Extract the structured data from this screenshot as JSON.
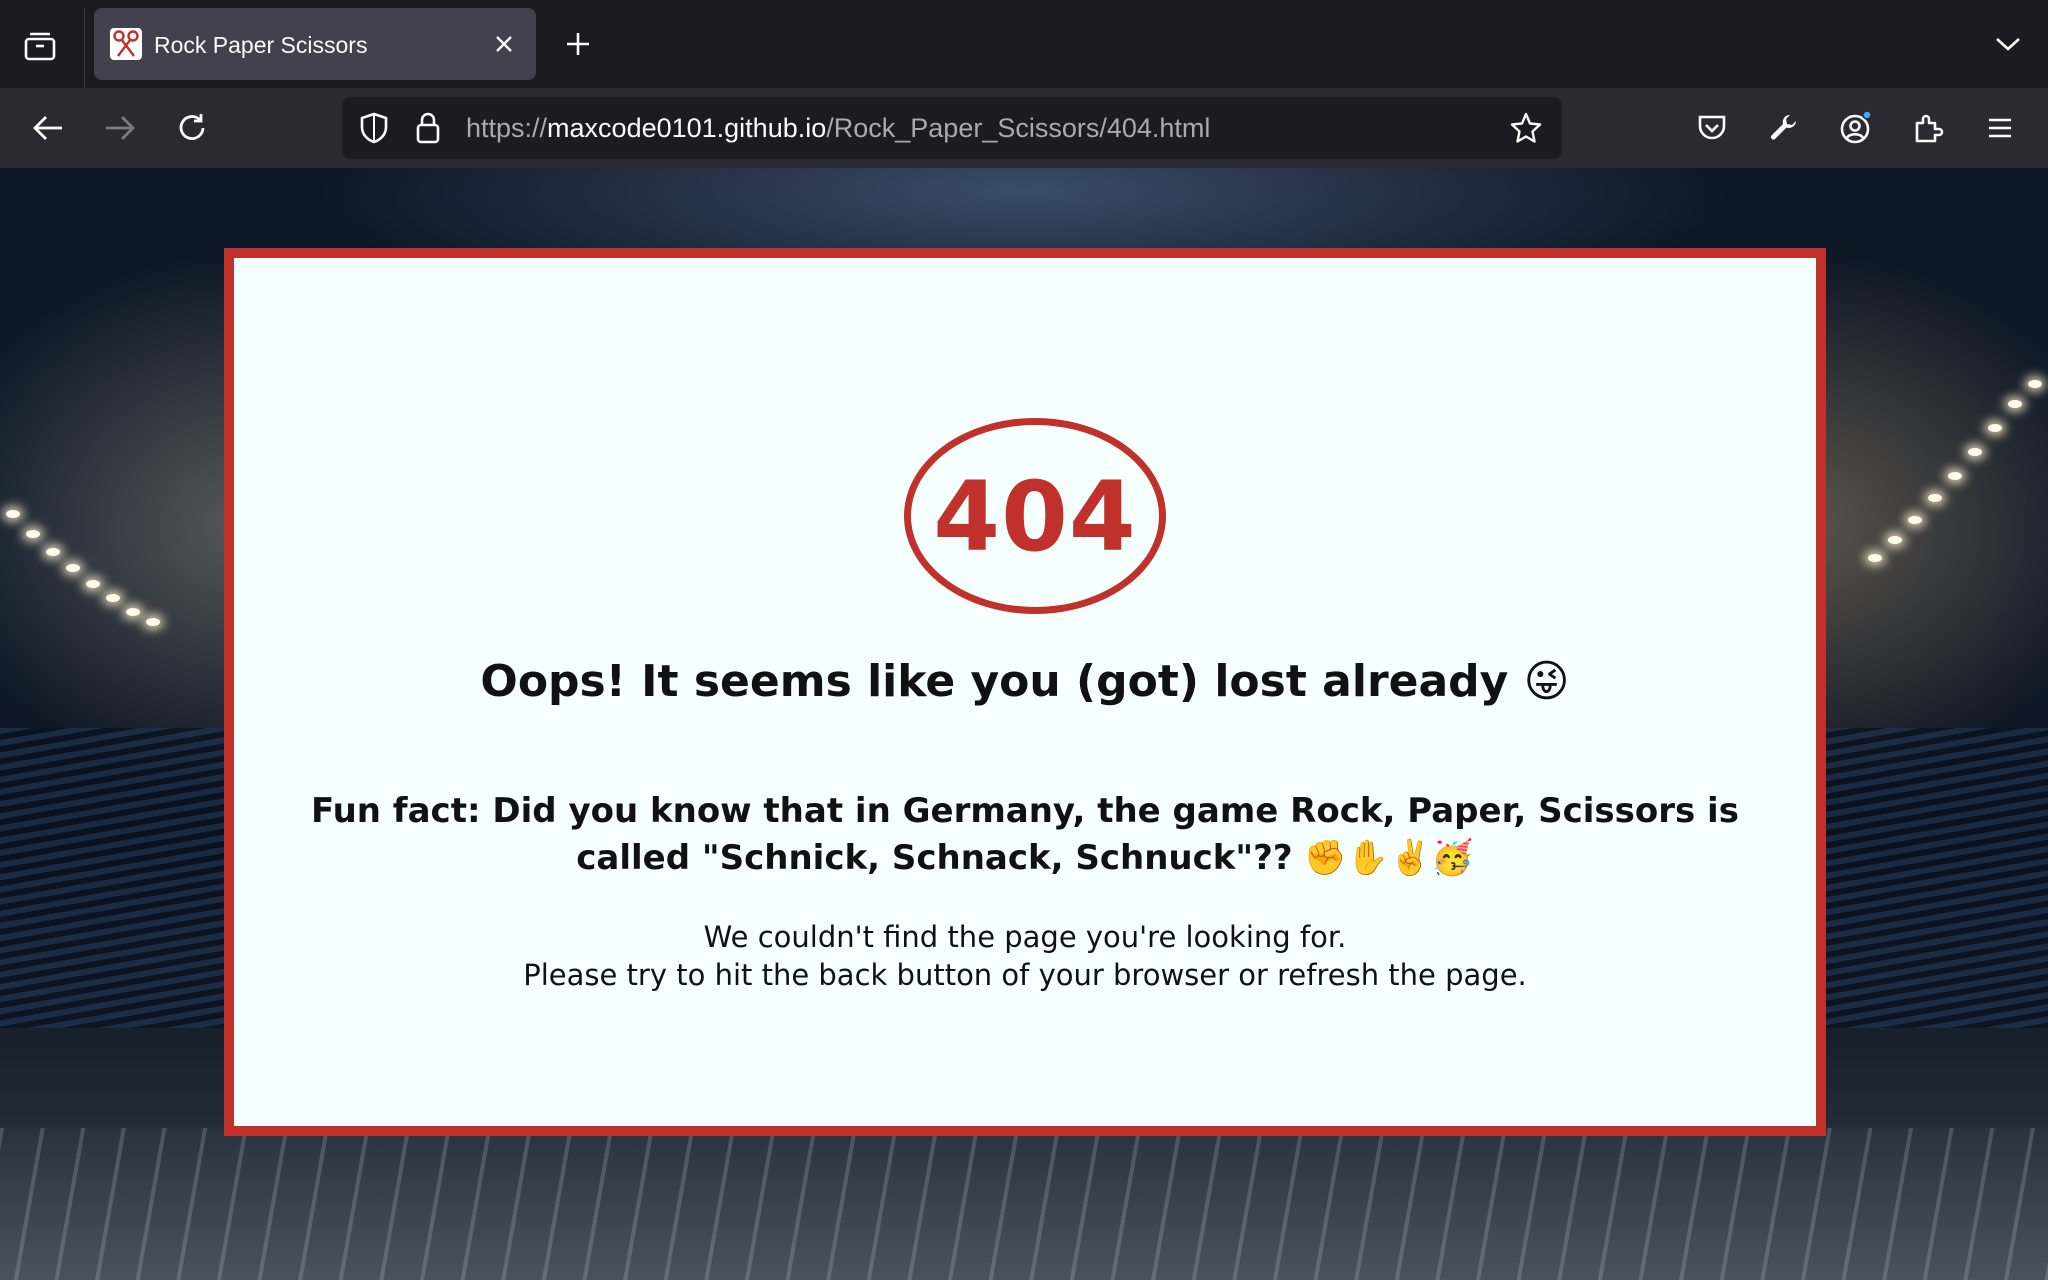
{
  "browser": {
    "tab": {
      "title": "Rock Paper Scissors",
      "favicon": "scissors-icon"
    },
    "url": {
      "scheme": "https://",
      "host": "maxcode0101.github.io",
      "path": "/Rock_Paper_Scissors/404.html"
    },
    "icons": {
      "tab_overview": "tab-overview-icon",
      "close": "close-icon",
      "new_tab": "plus-icon",
      "tab_list": "chevron-down-icon",
      "back": "back-arrow-icon",
      "forward": "forward-arrow-icon",
      "reload": "reload-icon",
      "tracking_protection": "shield-icon",
      "lock": "lock-icon",
      "bookmark": "star-icon",
      "pocket": "pocket-icon",
      "devtools": "wrench-icon",
      "account": "account-icon",
      "extensions": "puzzle-icon",
      "menu": "hamburger-menu-icon"
    }
  },
  "page": {
    "badge": "404",
    "headline": "Oops! It seems like you (got) lost already 😜",
    "funfact": "Fun fact: Did you know that in Germany, the game Rock, Paper, Scissors is called \"Schnick, Schnack, Schnuck\"?? ✊✋✌️🥳",
    "message_line1": "We couldn't find the page you're looking for.",
    "message_line2": "Please try to hit the back button of your browser or refresh the page."
  },
  "colors": {
    "accent": "#c0312b",
    "card_bg": "#f5fffe",
    "chrome_dark": "#1c1b22",
    "chrome_nav": "#2b2a33",
    "tab_active": "#42414d"
  }
}
